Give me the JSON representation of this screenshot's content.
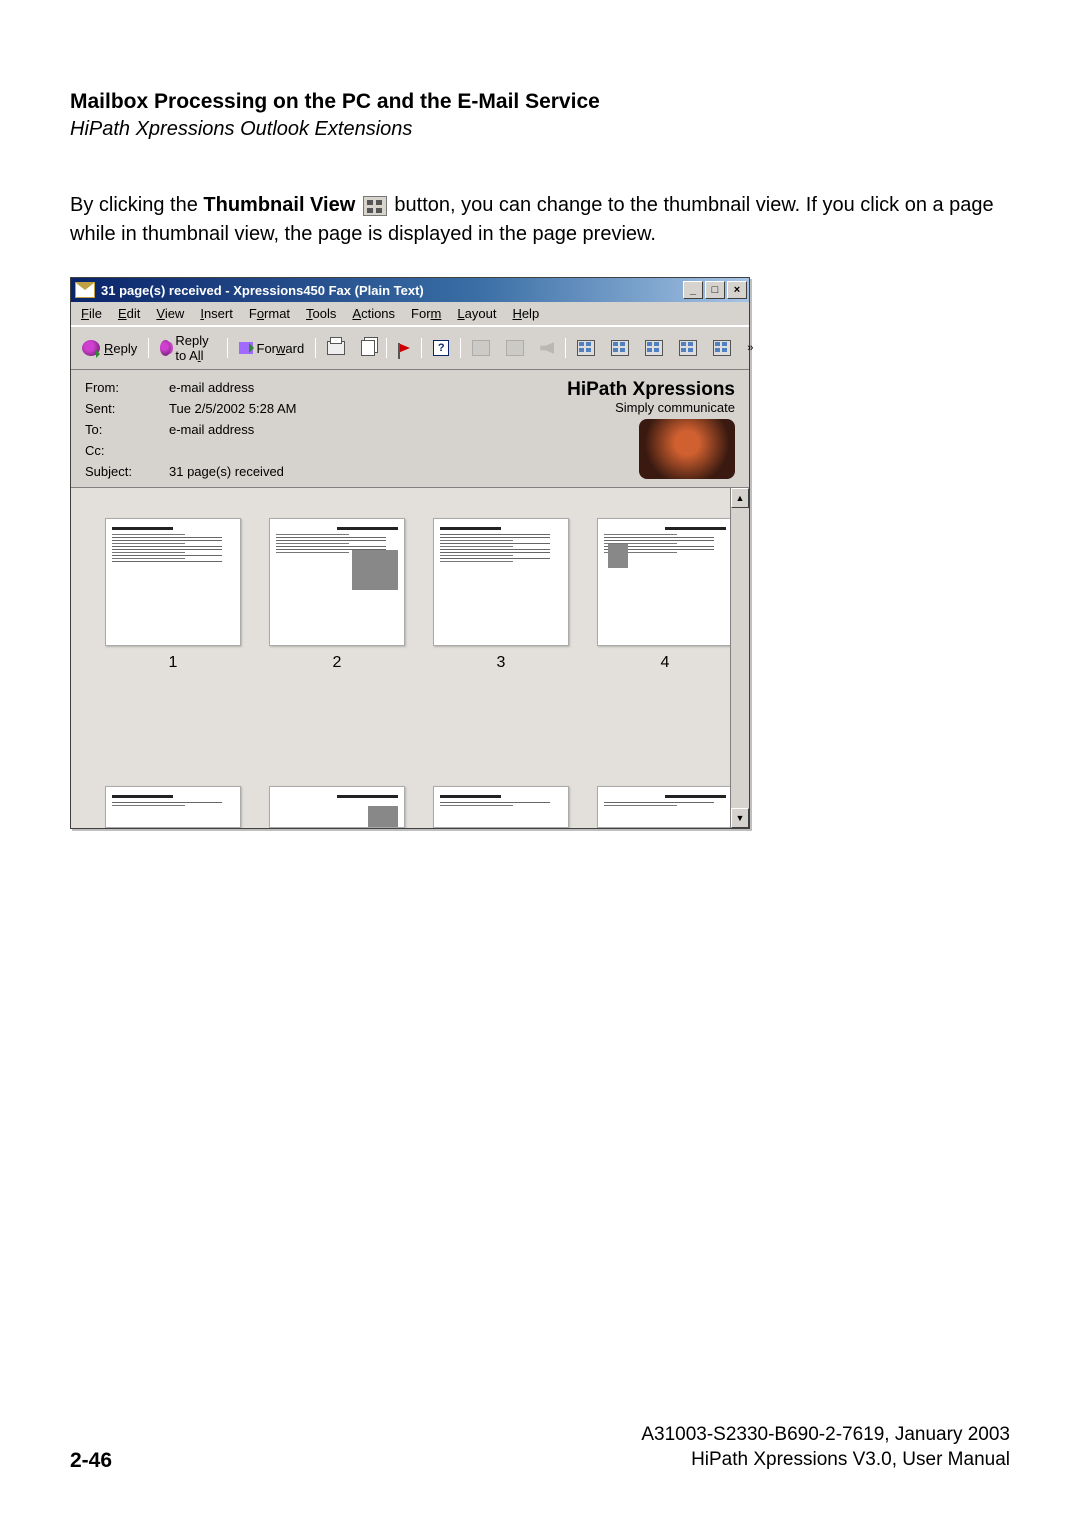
{
  "doc": {
    "heading": "Mailbox Processing on the PC and the E-Mail Service",
    "subheading": "HiPath Xpressions Outlook Extensions",
    "para_a": "By clicking the ",
    "para_bold": "Thumbnail View",
    "para_b": " button, you can change to the thumbnail view. If you click on a page while in thumbnail view, the page is displayed in the page preview.",
    "doc_id": "A31003-S2330-B690-2-7619, January 2003",
    "doc_ref": "HiPath Xpressions V3.0, User Manual",
    "page_num": "2-46"
  },
  "win": {
    "title": "31 page(s) received - Xpressions450 Fax (Plain Text)",
    "menus": [
      "File",
      "Edit",
      "View",
      "Insert",
      "Format",
      "Tools",
      "Actions",
      "Form",
      "Layout",
      "Help"
    ],
    "tb": {
      "reply": "Reply",
      "reply_all": "Reply to All",
      "forward": "Forward"
    },
    "hdr": {
      "from_lbl": "From:",
      "from_val": "e-mail address",
      "sent_lbl": "Sent:",
      "sent_val": "Tue 2/5/2002 5:28 AM",
      "to_lbl": "To:",
      "to_val": "e-mail address",
      "cc_lbl": "Cc:",
      "cc_val": "",
      "subj_lbl": "Subject:",
      "subj_val": "31 page(s) received"
    },
    "brand": {
      "title": "HiPath Xpressions",
      "sub": "Simply communicate"
    },
    "thumb_labels": [
      "1",
      "2",
      "3",
      "4"
    ]
  }
}
